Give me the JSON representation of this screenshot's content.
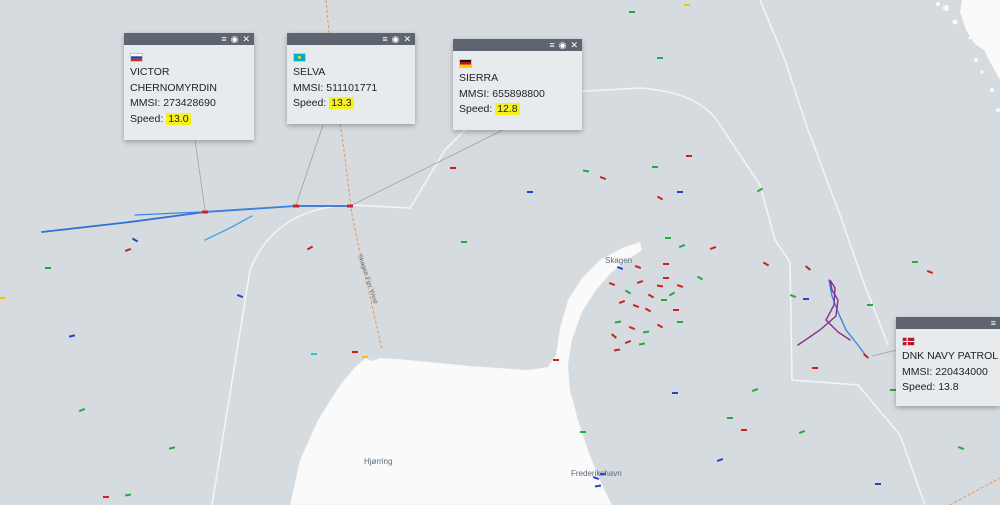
{
  "places": {
    "skagen": "Skagen",
    "hjorring": "Hjørring",
    "frederikshavn": "Frederikshavn",
    "fairway": "Skagen Fjer West"
  },
  "popups": [
    {
      "id": "victor",
      "flag": "russia",
      "name_line1": "VICTOR",
      "name_line2": "CHERNOMYRDIN",
      "mmsi_label": "MMSI:",
      "mmsi": "273428690",
      "speed_label": "Speed:",
      "speed": "13.0",
      "speed_highlighted": true
    },
    {
      "id": "selva",
      "flag": "kazakhstan",
      "name_line1": "SELVA",
      "mmsi_label": "MMSI:",
      "mmsi": "511101771",
      "speed_label": "Speed:",
      "speed": "13.3",
      "speed_highlighted": true
    },
    {
      "id": "sierra",
      "flag": "germany",
      "name_line1": "SIERRA",
      "mmsi_label": "MMSI:",
      "mmsi": "655898800",
      "speed_label": "Speed:",
      "speed": "12.8",
      "speed_highlighted": true
    },
    {
      "id": "dnk",
      "flag": "denmark",
      "name_line1": "DNK NAVY PATROL P",
      "mmsi_label": "MMSI:",
      "mmsi": "220434000",
      "speed_label": "Speed:",
      "speed": "13.8",
      "speed_highlighted": false
    }
  ],
  "popup_controls": {
    "list_icon": "list-edit-icon",
    "hide_icon": "eye-slash-icon",
    "close_icon": "close-icon"
  },
  "colors": {
    "sea": "#d5dbdf",
    "land": "#fafafa",
    "popup_bar": "#5f6570",
    "popup_body": "#e7ebee",
    "highlight": "#f6f21a",
    "track_blue": "#2f6fd6",
    "track_purple": "#8b2d8e",
    "fairway": "#e8955a"
  }
}
